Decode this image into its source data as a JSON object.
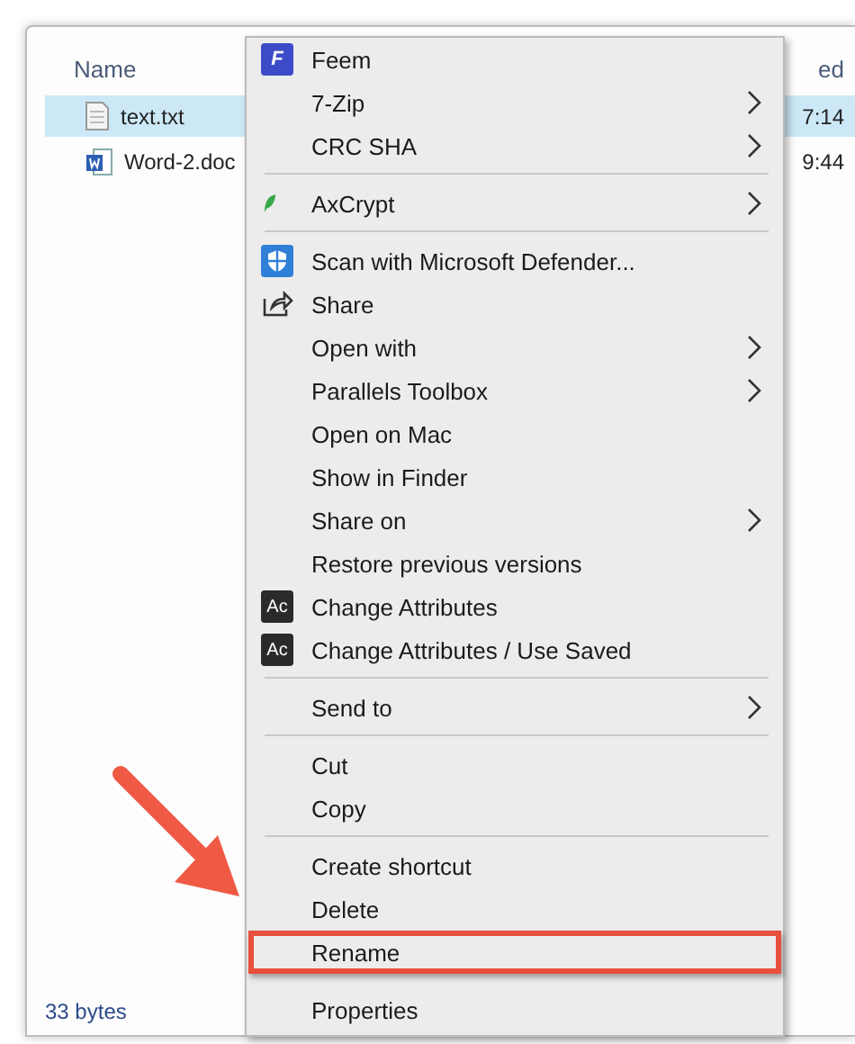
{
  "explorer": {
    "column_header": "Name",
    "column_2_header": "ed",
    "files": [
      {
        "name": "text.txt",
        "time": "7:14",
        "selected": true,
        "kind": "text"
      },
      {
        "name": "Word-2.doc",
        "time": "9:44",
        "selected": false,
        "kind": "word"
      }
    ],
    "status_bar": "33 bytes"
  },
  "menu": [
    {
      "kind": "feem",
      "label": "Feem",
      "icon_text": "F",
      "submenu": false,
      "selected": false
    },
    {
      "kind": "plain",
      "label": "7-Zip",
      "submenu": true,
      "selected": false
    },
    {
      "kind": "plain",
      "label": "CRC SHA",
      "submenu": true,
      "selected": false
    },
    {
      "kind": "separator"
    },
    {
      "kind": "axcrypt",
      "label": "AxCrypt",
      "submenu": true,
      "selected": false
    },
    {
      "kind": "separator"
    },
    {
      "kind": "defender",
      "label": "Scan with Microsoft Defender...",
      "submenu": false,
      "selected": false
    },
    {
      "kind": "share",
      "label": "Share",
      "submenu": false,
      "selected": false
    },
    {
      "kind": "plain",
      "label": "Open with",
      "submenu": true,
      "selected": false
    },
    {
      "kind": "plain",
      "label": "Parallels Toolbox",
      "submenu": true,
      "selected": false
    },
    {
      "kind": "plain",
      "label": "Open on Mac",
      "submenu": false,
      "selected": false
    },
    {
      "kind": "plain",
      "label": "Show in Finder",
      "submenu": false,
      "selected": false
    },
    {
      "kind": "plain",
      "label": "Share on",
      "submenu": true,
      "selected": false
    },
    {
      "kind": "plain",
      "label": "Restore previous versions",
      "submenu": false,
      "selected": false
    },
    {
      "kind": "ac",
      "label": "Change Attributes",
      "icon_text": "Ac",
      "submenu": false,
      "selected": false
    },
    {
      "kind": "ac",
      "label": "Change Attributes / Use Saved",
      "icon_text": "Ac",
      "submenu": false,
      "selected": false
    },
    {
      "kind": "separator"
    },
    {
      "kind": "plain",
      "label": "Send to",
      "submenu": true,
      "selected": false
    },
    {
      "kind": "separator"
    },
    {
      "kind": "plain",
      "label": "Cut",
      "submenu": false,
      "selected": false
    },
    {
      "kind": "plain",
      "label": "Copy",
      "submenu": false,
      "selected": false
    },
    {
      "kind": "separator"
    },
    {
      "kind": "plain",
      "label": "Create shortcut",
      "submenu": false,
      "selected": false
    },
    {
      "kind": "plain",
      "label": "Delete",
      "submenu": false,
      "selected": false
    },
    {
      "kind": "plain",
      "label": "Rename",
      "submenu": false,
      "selected": true
    },
    {
      "kind": "plain",
      "label": "Properties",
      "submenu": false,
      "selected": false
    }
  ]
}
